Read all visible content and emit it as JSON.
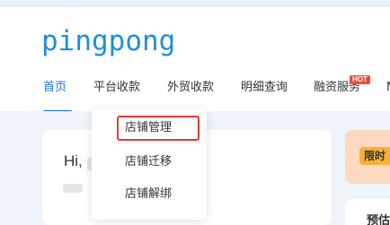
{
  "logo": {
    "text": "pingpong"
  },
  "nav": {
    "items": [
      {
        "label": "首页",
        "active": true
      },
      {
        "label": "平台收款"
      },
      {
        "label": "外贸收款"
      },
      {
        "label": "明细查询"
      },
      {
        "label": "融资服务",
        "badge": "HOT"
      },
      {
        "label": "N"
      }
    ]
  },
  "dropdown": {
    "items": [
      {
        "label": "店铺管理",
        "highlighted": true
      },
      {
        "label": "店铺迁移"
      },
      {
        "label": "店铺解绑"
      }
    ]
  },
  "welcome": {
    "greeting": "Hi,"
  },
  "promo": {
    "badge": "限时"
  },
  "bottom_card": {
    "title": "预估"
  },
  "colors": {
    "accent": "#1a73e8",
    "logo": "#1f8fd6",
    "hot_badge": "#f04b3c",
    "highlight_outline": "#e53935",
    "promo_bg": "#fcd9c0",
    "promo_badge": "#f9b036"
  }
}
